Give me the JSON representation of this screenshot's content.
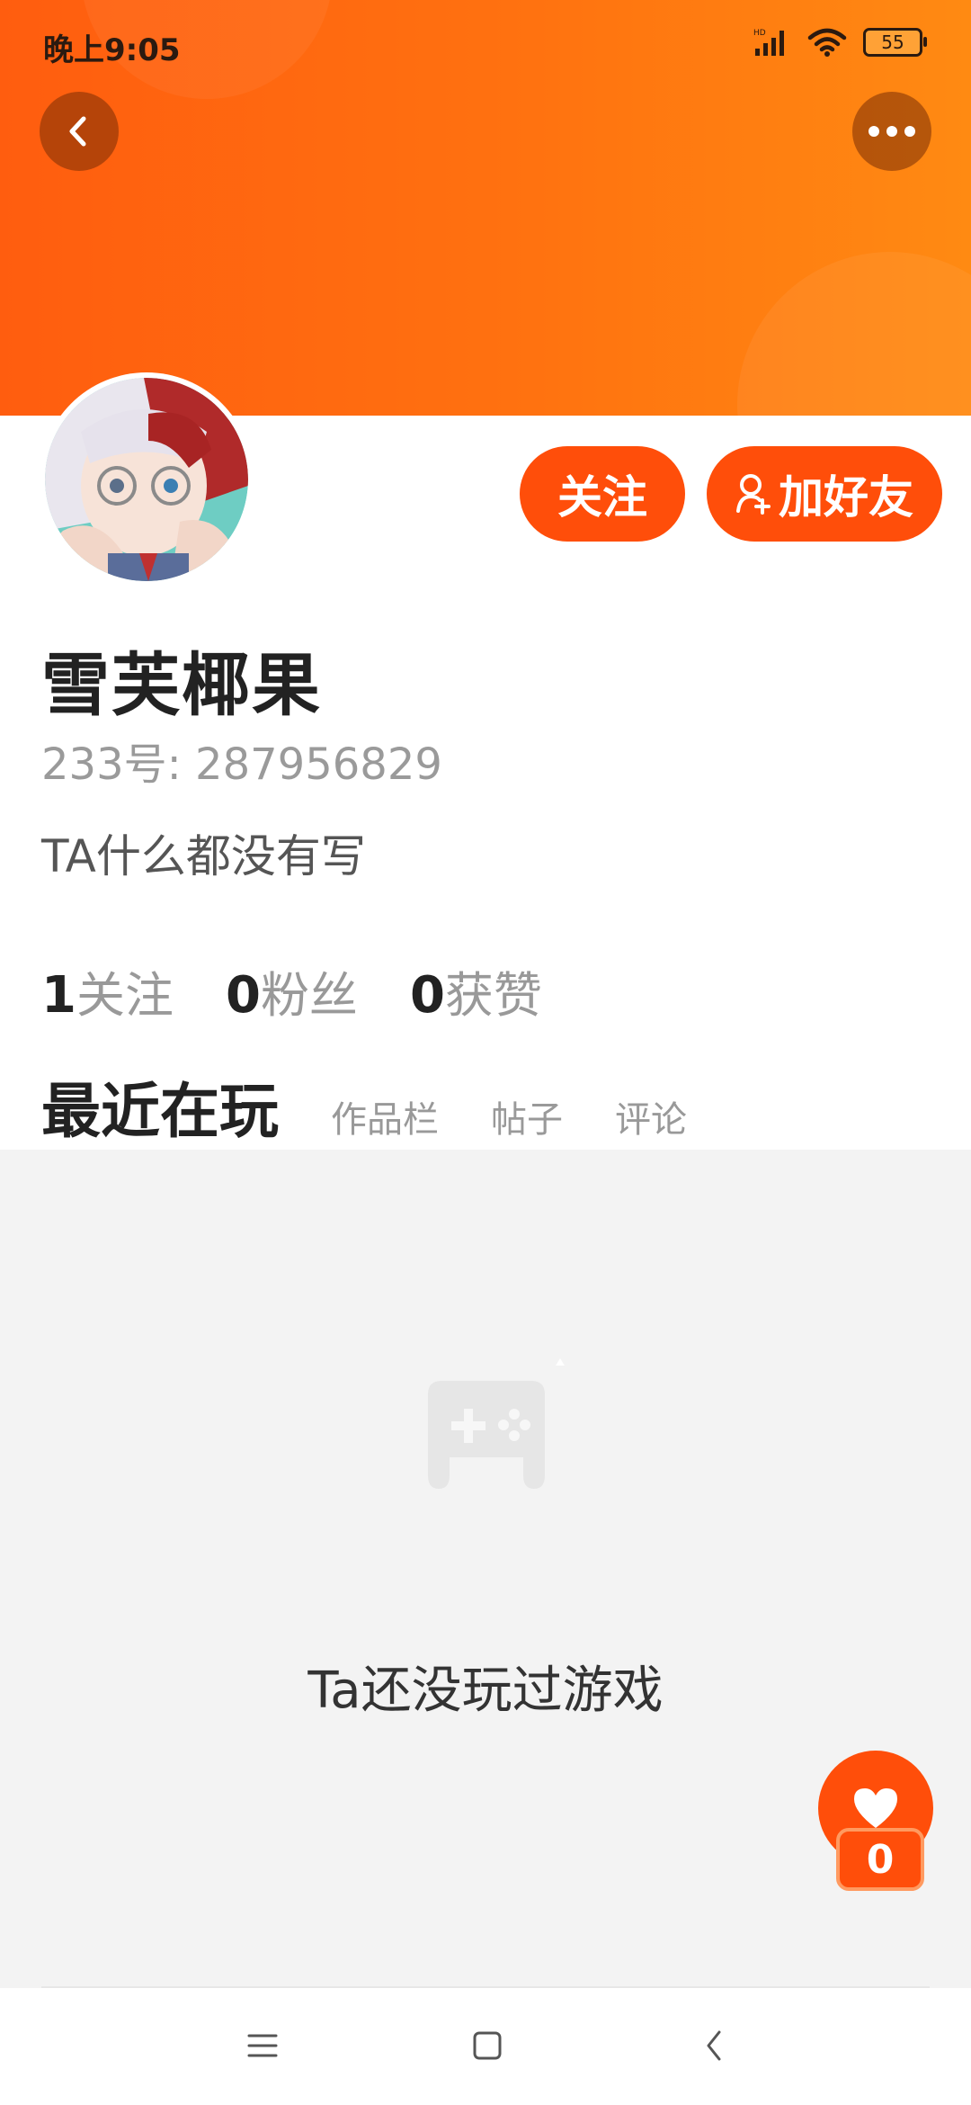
{
  "status_bar": {
    "time": "晚上9:05",
    "battery": "55"
  },
  "header": {
    "back_icon": "chevron-left-icon",
    "more_icon": "more-horizontal-icon"
  },
  "actions": {
    "follow_label": "关注",
    "add_friend_label": "加好友",
    "add_friend_icon": "user-plus-icon"
  },
  "profile": {
    "name": "雪芙椰果",
    "uid": "233号: 287956829",
    "bio": "TA什么都没有写"
  },
  "stats": [
    {
      "value": "1",
      "label": "关注"
    },
    {
      "value": "0",
      "label": "粉丝"
    },
    {
      "value": "0",
      "label": "获赞"
    }
  ],
  "tabs": [
    {
      "label": "最近在玩"
    },
    {
      "label": "作品栏"
    },
    {
      "label": "帖子"
    },
    {
      "label": "评论"
    }
  ],
  "empty_state": {
    "icon": "gamepad-icon",
    "text": "Ta还没玩过游戏"
  },
  "like": {
    "icon": "heart-icon",
    "count": "0"
  },
  "colors": {
    "accent": "#ff4e0a",
    "banner_start": "#ff5d0f",
    "banner_end": "#ff8a12"
  }
}
